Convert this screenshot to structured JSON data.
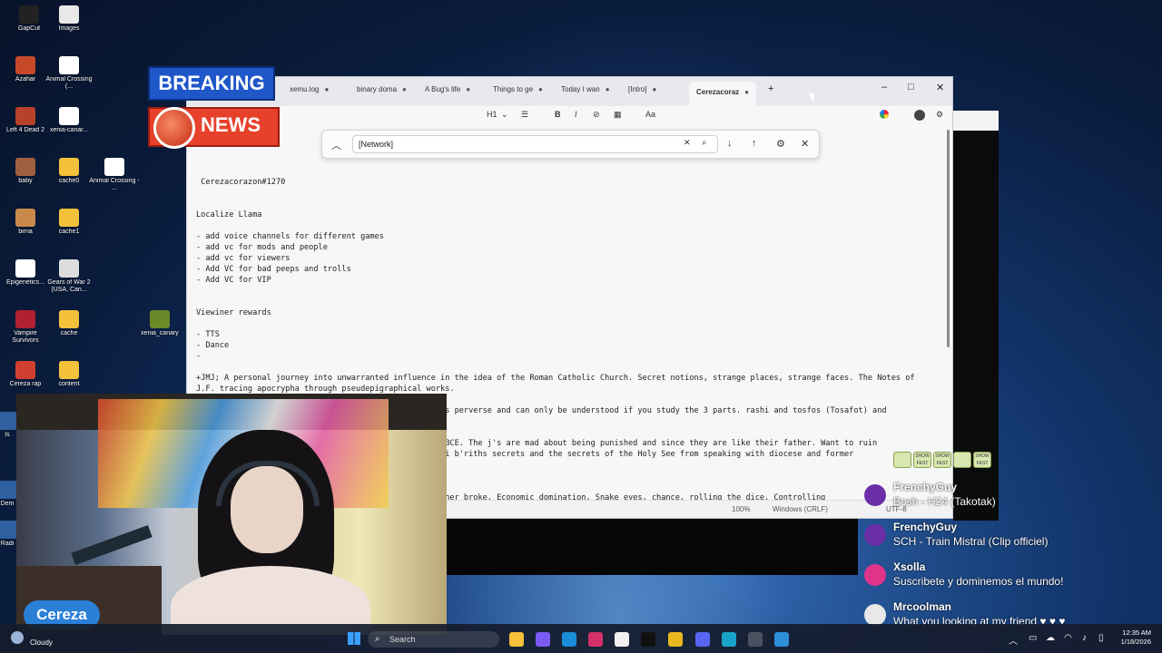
{
  "desktop_icons": [
    {
      "label": "GapCut",
      "color": "#222222"
    },
    {
      "label": "Images",
      "color": "#e8e8e8"
    },
    {
      "label": "Azahar",
      "color": "#c64a2a"
    },
    {
      "label": "Animal Crossing (...",
      "color": "#ffffff"
    },
    {
      "label": "Left 4 Dead 2",
      "color": "#b8412a"
    },
    {
      "label": "xenia-canar...",
      "color": "#ffffff"
    },
    {
      "label": "baby",
      "color": "#a06040"
    },
    {
      "label": "cache0",
      "color": "#f3c13a"
    },
    {
      "label": "Animal Crossing - ...",
      "color": "#ffffff"
    },
    {
      "label": "birria",
      "color": "#c88a4a"
    },
    {
      "label": "cache1",
      "color": "#f3c13a"
    },
    {
      "label": "Epigenetics...",
      "color": "#ffffff"
    },
    {
      "label": "Gears of War 2 (USA, Can...",
      "color": "#dddddd"
    },
    {
      "label": "Vampire Survivors",
      "color": "#b02030"
    },
    {
      "label": "cache",
      "color": "#f3c13a"
    },
    {
      "label": "xenia_canary",
      "color": "#6a8a2a"
    },
    {
      "label": "Cereza rap",
      "color": "#d04030"
    },
    {
      "label": "content",
      "color": "#f3c13a"
    },
    {
      "label": "Is",
      "color": "#3060a0"
    },
    {
      "label": "Dem",
      "color": "#3060a0"
    },
    {
      "label": "Radi",
      "color": "#3060a0"
    }
  ],
  "overlay": {
    "breaking": "BREAKING",
    "news": "NEWS",
    "name_tag": "Cereza"
  },
  "editor": {
    "tabs": [
      {
        "label": "xemu.log",
        "active": false
      },
      {
        "label": "binary doma",
        "active": false
      },
      {
        "label": "A Bug's life",
        "active": false
      },
      {
        "label": "Things to ge",
        "active": false
      },
      {
        "label": "Today I wan",
        "active": false
      },
      {
        "label": "[Intro]",
        "active": false
      },
      {
        "label": "Cerezacoraz",
        "active": true
      }
    ],
    "new_tab": "+",
    "window_buttons": {
      "minimize": "–",
      "maximize": "□",
      "close": "✕"
    },
    "toolbar": {
      "heading": "H1",
      "list": "☰",
      "bold": "B",
      "italic": "I",
      "link": "⊘",
      "table": "▦",
      "spell": "Aa",
      "chevron": "⌄"
    },
    "find": {
      "value": "[Network]",
      "collapse": "︿",
      "clear": "✕",
      "search": "⌕",
      "next": "↓",
      "previous": "↑",
      "options": "⚙",
      "close": "✕"
    },
    "content_lines": [
      "",
      " Cerezacorazon#1270",
      "",
      "",
      "Localize Llama",
      "",
      "- add voice channels for different games",
      "- add vc for mods and people",
      "- add vc for viewers",
      "- Add VC for bad peeps and trolls",
      "- Add VC for VIP",
      "",
      "",
      "Viewiner rewards",
      "",
      "- TTS",
      "- Dance",
      "-",
      "",
      "+JMJ; A personal journey into unwarranted influence in the idea of the Roman Catholic Church. Secret notions, strange places, strange faces. The Notes of",
      "J.F. tracing apocrypha through pseudepigraphical works.",
      "",
      "                                               lmud is perverse and can only be understood if you study the 3 parts. rashi and tosfos (Tosafot) and",
      "",
      "",
      "                                               k 600 BCE. The j's are mad about being punished and since they are like their father. Want to ruin",
      "                                               , b'nai b'riths secrets and the secrets of the Holy See from speaking with diocese and former",
      "",
      "",
      "",
      "                                               ing other broke, Economic domination, Snake eyes, chance, rolling the dice, Controlling",
      "                                               . Get out free. Taxes. Selling and buying. About broken friendships."
    ],
    "status": {
      "zoom": "100%",
      "line_ending": "Windows (CRLF)",
      "encoding": "UTF-8"
    }
  },
  "chat": {
    "badges": [
      "",
      "SHOW FEST",
      "SHOW FEST",
      "",
      "SHOW FEST"
    ],
    "messages": [
      {
        "user": "FrenchyGuy",
        "text": "Bosh - H24 (Takotak)",
        "avatar_color": "#6b2fa8"
      },
      {
        "user": "FrenchyGuy",
        "text": "SCH - Train Mistral (Clip officiel)",
        "avatar_color": "#6b2fa8"
      },
      {
        "user": "Xsolla",
        "text": "Suscribete y dominemos el mundo!",
        "avatar_color": "#e0338a"
      },
      {
        "user": "Mrcoolman",
        "text": "What you looking at my friend ♥ ♥ ♥",
        "avatar_color": "#e8e8e8"
      }
    ]
  },
  "taskbar": {
    "weather": "Cloudy",
    "search_placeholder": "Search",
    "search_icon": "⌕",
    "apps": [
      {
        "name": "file-explorer",
        "color": "#f3c13a"
      },
      {
        "name": "copilot",
        "color": "#7a5af5"
      },
      {
        "name": "edge",
        "color": "#1a8cd8"
      },
      {
        "name": "instagram",
        "color": "#d6306b"
      },
      {
        "name": "amazon",
        "color": "#f0f0f0"
      },
      {
        "name": "x",
        "color": "#111111"
      },
      {
        "name": "chrome",
        "color": "#e8b820"
      },
      {
        "name": "discord",
        "color": "#5865f2"
      },
      {
        "name": "vpn",
        "color": "#1aa3c8"
      },
      {
        "name": "app",
        "color": "#4a5060"
      },
      {
        "name": "notepad",
        "color": "#2d8fd8"
      }
    ],
    "tray": "︿",
    "time": "12:35 AM",
    "date": "1/18/2026"
  }
}
